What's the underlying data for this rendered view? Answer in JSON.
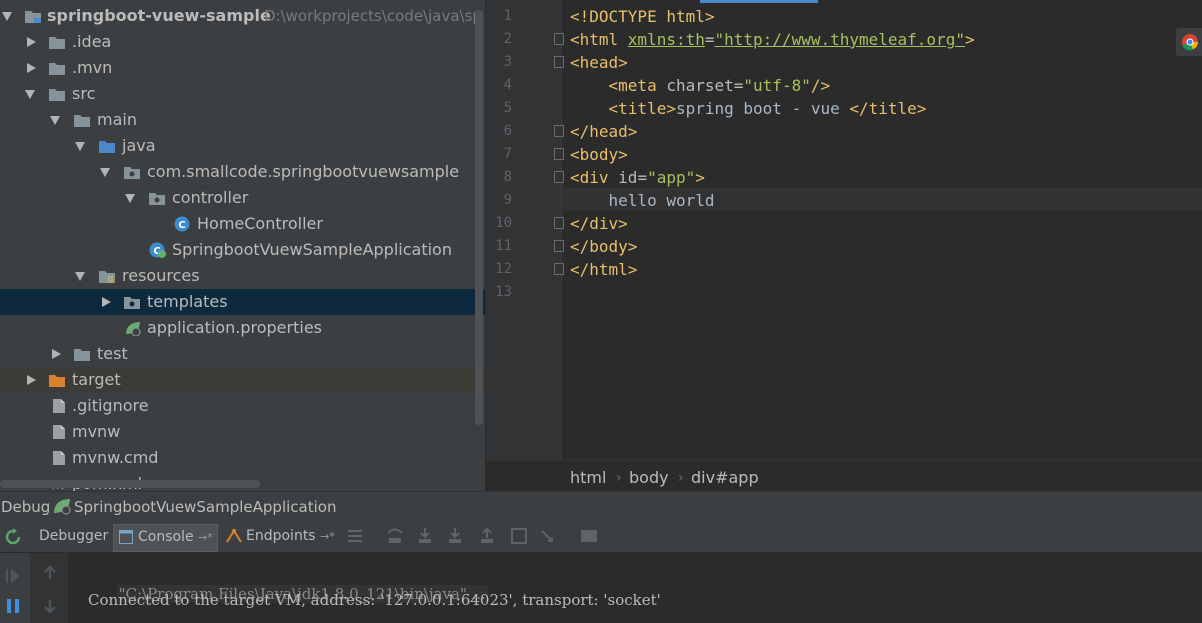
{
  "project_tree": {
    "root": {
      "label": "springboot-vuew-sample",
      "path": "D:\\workprojects\\code\\java\\sp"
    },
    "items": [
      {
        "label": ".idea"
      },
      {
        "label": ".mvn"
      },
      {
        "label": "src"
      },
      {
        "label": "main"
      },
      {
        "label": "java"
      },
      {
        "label": "com.smallcode.springbootvuewsample"
      },
      {
        "label": "controller"
      },
      {
        "label": "HomeController"
      },
      {
        "label": "SpringbootVuewSampleApplication"
      },
      {
        "label": "resources"
      },
      {
        "label": "templates"
      },
      {
        "label": "application.properties"
      },
      {
        "label": "test"
      },
      {
        "label": "target"
      },
      {
        "label": ".gitignore"
      },
      {
        "label": "mvnw"
      },
      {
        "label": "mvnw.cmd"
      },
      {
        "label": "pom.xml"
      }
    ]
  },
  "editor": {
    "line_numbers": [
      "1",
      "2",
      "3",
      "4",
      "5",
      "6",
      "7",
      "8",
      "9",
      "10",
      "11",
      "12",
      "13"
    ],
    "lines": [
      {
        "tokens": [
          {
            "t": "<!DOCTYPE html>",
            "c": "doctype"
          }
        ]
      },
      {
        "tokens": [
          {
            "t": "<html ",
            "c": "tag"
          },
          {
            "t": "xmlns:th",
            "c": "url"
          },
          {
            "t": "=",
            "c": "attr"
          },
          {
            "t": "\"http://www.thymeleaf.org\"",
            "c": "url"
          },
          {
            "t": ">",
            "c": "tag"
          }
        ]
      },
      {
        "tokens": [
          {
            "t": "<head>",
            "c": "tag"
          }
        ]
      },
      {
        "tokens": [
          {
            "t": "    ",
            "c": "text"
          },
          {
            "t": "<meta ",
            "c": "tag"
          },
          {
            "t": "charset",
            "c": "attr"
          },
          {
            "t": "=",
            "c": "attr"
          },
          {
            "t": "\"utf-8\"",
            "c": "str"
          },
          {
            "t": "/>",
            "c": "tag"
          }
        ]
      },
      {
        "tokens": [
          {
            "t": "    ",
            "c": "text"
          },
          {
            "t": "<title>",
            "c": "tag"
          },
          {
            "t": "spring boot - vue ",
            "c": "text"
          },
          {
            "t": "</title>",
            "c": "tag"
          }
        ]
      },
      {
        "tokens": [
          {
            "t": "</head>",
            "c": "tag"
          }
        ]
      },
      {
        "tokens": [
          {
            "t": "<body>",
            "c": "tag"
          }
        ]
      },
      {
        "tokens": [
          {
            "t": "<div ",
            "c": "tag"
          },
          {
            "t": "id",
            "c": "attr"
          },
          {
            "t": "=",
            "c": "attr"
          },
          {
            "t": "\"app\"",
            "c": "str"
          },
          {
            "t": ">",
            "c": "tag"
          }
        ]
      },
      {
        "tokens": [
          {
            "t": "    hello world",
            "c": "text"
          }
        ]
      },
      {
        "tokens": [
          {
            "t": "</div>",
            "c": "tag"
          }
        ]
      },
      {
        "tokens": [
          {
            "t": "</body>",
            "c": "tag"
          }
        ]
      },
      {
        "tokens": [
          {
            "t": "</html>",
            "c": "tag"
          }
        ]
      },
      {
        "tokens": []
      }
    ],
    "breadcrumbs": [
      "html",
      "body",
      "div#app"
    ]
  },
  "debug": {
    "title": "Debug",
    "run_config": "SpringbootVuewSampleApplication",
    "tabs": {
      "debugger": "Debugger",
      "console": "Console",
      "endpoints": "Endpoints"
    },
    "console_lines": {
      "command": "\"C:\\Program Files\\Java\\jdk1.8.0_121\\bin\\java\" ...",
      "output": "Connected to the target VM, address: '127.0.0.1:64023', transport: 'socket'"
    }
  },
  "colors": {
    "panel_bg": "#3c3f41",
    "editor_bg": "#2b2b2b",
    "tag": "#e8bf6a",
    "string": "#a5c25c",
    "selection": "#0d293e"
  }
}
